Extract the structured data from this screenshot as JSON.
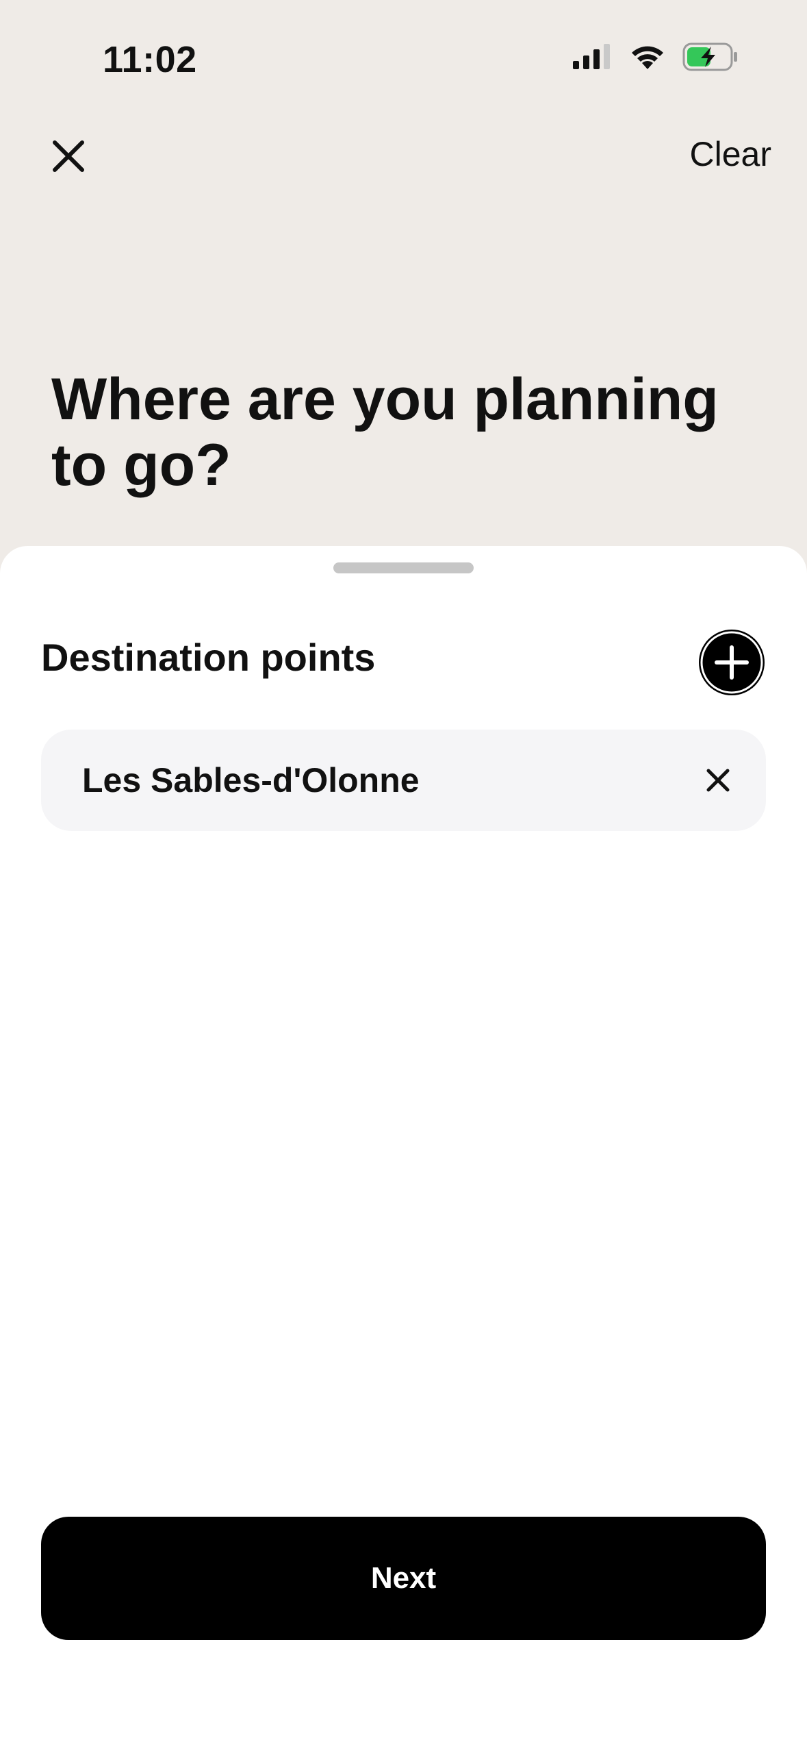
{
  "status_bar": {
    "time": "11:02",
    "icons": [
      "signal-icon",
      "wifi-icon",
      "battery-charging-icon"
    ],
    "battery_color": "#34c759"
  },
  "nav": {
    "close_icon": "close-icon",
    "clear_label": "Clear"
  },
  "title": "Where are you planning to go?",
  "sheet": {
    "section_title": "Destination points",
    "add_icon": "plus-icon",
    "destinations": [
      {
        "label": "Les Sables-d'Olonne"
      }
    ],
    "next_label": "Next"
  },
  "colors": {
    "background": "#efebe7",
    "sheet": "#ffffff",
    "row": "#f5f5f7",
    "primary": "#000000"
  }
}
